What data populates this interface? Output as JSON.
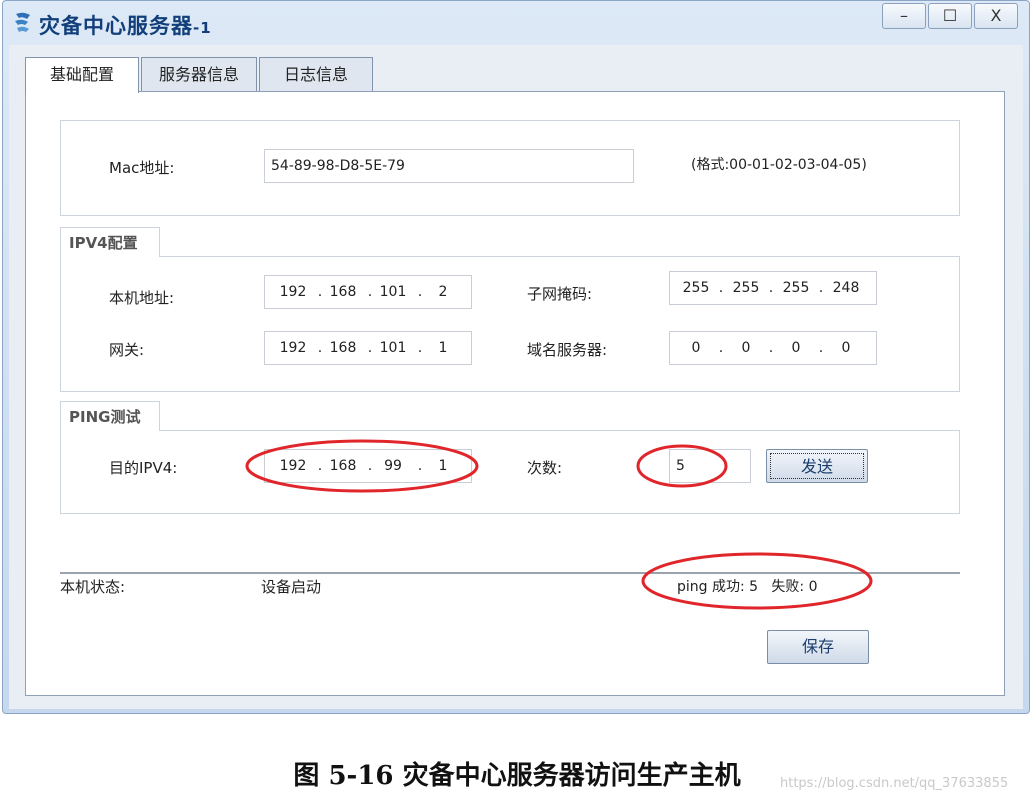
{
  "window": {
    "title": "灾备中心服务器",
    "title_suffix": "-1",
    "icon": "server-app-icon",
    "minimize_label": "–",
    "maximize_label": "☐",
    "close_label": "X"
  },
  "tabs": [
    {
      "label": "基础配置",
      "active": true
    },
    {
      "label": "服务器信息",
      "active": false
    },
    {
      "label": "日志信息",
      "active": false
    }
  ],
  "mac": {
    "label": "Mac地址:",
    "value": "54-89-98-D8-5E-79",
    "hint": "(格式:00-01-02-03-04-05)"
  },
  "ipv4": {
    "section_title": "IPV4配置",
    "local_ip_label": "本机地址:",
    "local_ip": [
      "192",
      "168",
      "101",
      "2"
    ],
    "mask_label": "子网掩码:",
    "mask": [
      "255",
      "255",
      "255",
      "248"
    ],
    "gateway_label": "网关:",
    "gateway": [
      "192",
      "168",
      "101",
      "1"
    ],
    "dns_label": "域名服务器:",
    "dns": [
      "0",
      "0",
      "0",
      "0"
    ]
  },
  "ping": {
    "section_title": "PING测试",
    "target_label": "目的IPV4:",
    "target": [
      "192",
      "168",
      "99",
      "1"
    ],
    "count_label": "次数:",
    "count": "5",
    "send_label": "发送"
  },
  "status": {
    "label": "本机状态:",
    "value": "设备启动",
    "result": "ping 成功: 5   失败: 0"
  },
  "save_label": "保存",
  "caption": "图 5-16 灾备中心服务器访问生产主机",
  "watermark": "https://blog.csdn.net/qq_37633855",
  "colors": {
    "highlight_circle": "#e0262a",
    "title_text": "#123f7a",
    "window_frame": "#c5d8ee"
  }
}
